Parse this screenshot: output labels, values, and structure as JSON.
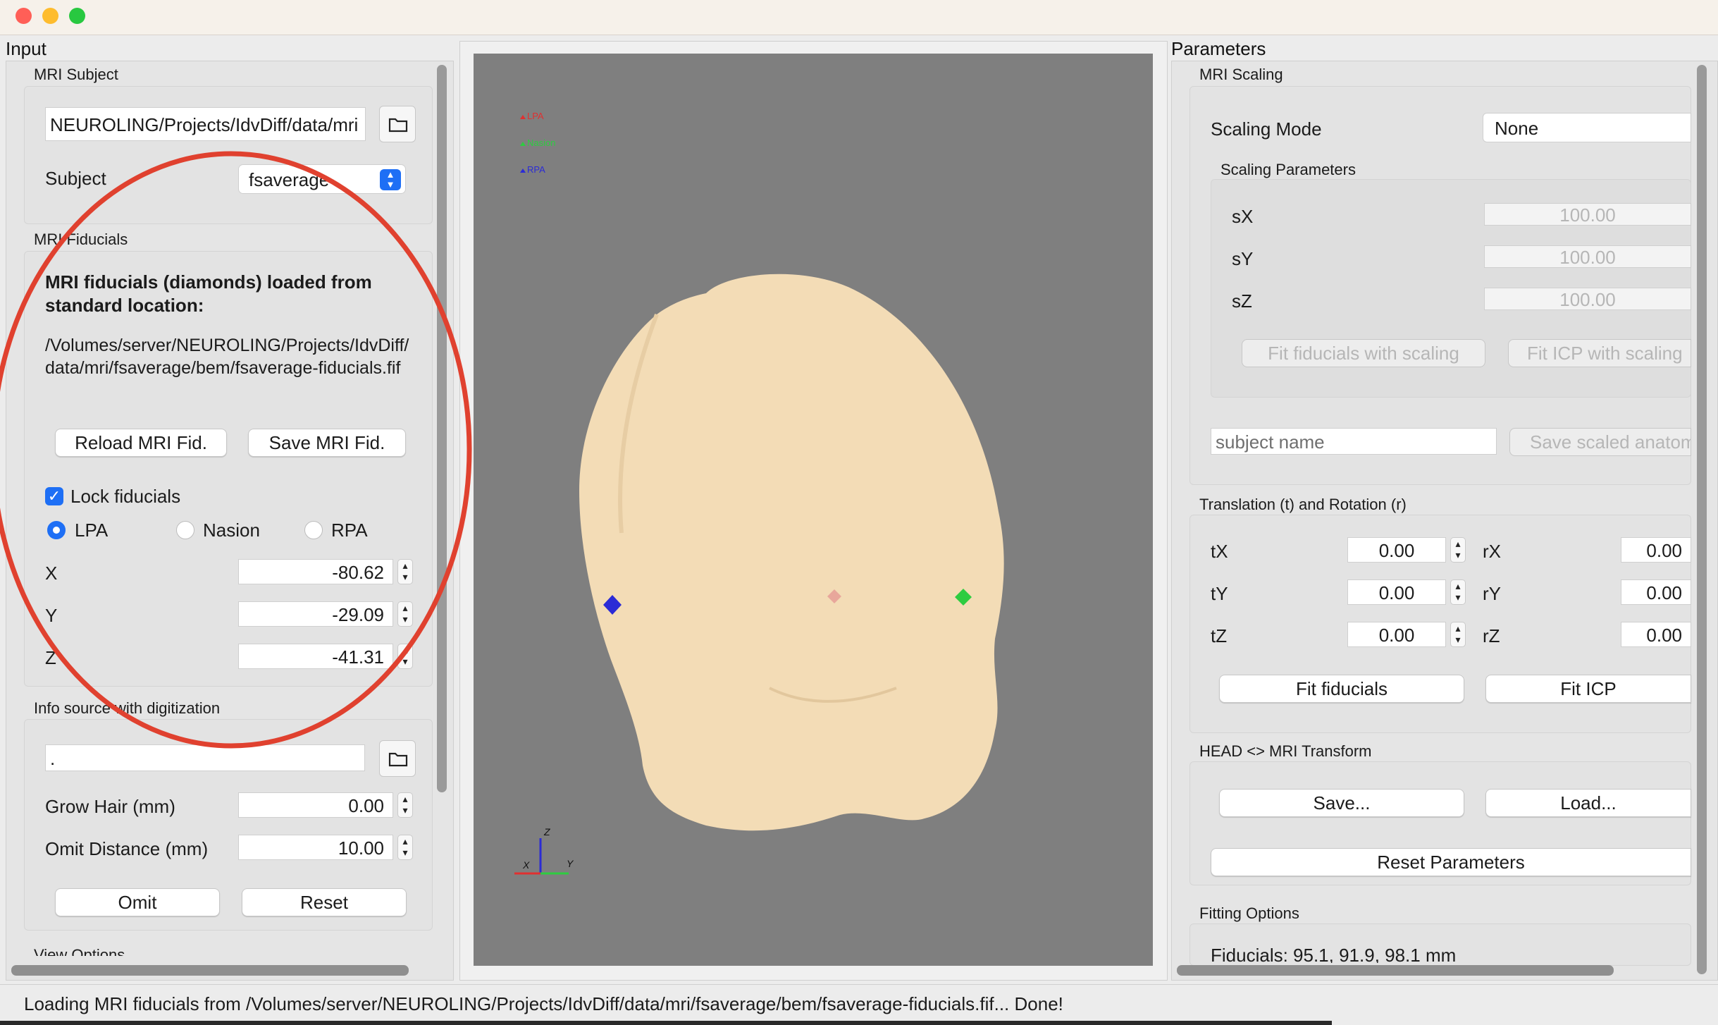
{
  "window": {
    "traffic_lights": [
      "#ff5f57",
      "#febc2e",
      "#28c840"
    ]
  },
  "input_panel": {
    "title": "Input",
    "mri_subject": {
      "group_title": "MRI Subject",
      "path_value": "NEUROLING/Projects/IdvDiff/data/mri",
      "subject_label": "Subject",
      "subject_value": "fsaverage"
    },
    "mri_fiducials": {
      "group_title": "MRI Fiducials",
      "heading": "MRI fiducials (diamonds) loaded from standard location:",
      "path_text": "/Volumes/server/NEUROLING/Projects/IdvDiff/data/mri/fsaverage/bem/fsaverage-fiducials.fif",
      "reload_label": "Reload MRI Fid.",
      "save_label": "Save MRI Fid.",
      "lock_label": "Lock fiducials",
      "lock_checked": true,
      "radio_lpa": "LPA",
      "radio_nasion": "Nasion",
      "radio_rpa": "RPA",
      "selected": "LPA",
      "x_label": "X",
      "x_value": "-80.62",
      "y_label": "Y",
      "y_value": "-29.09",
      "z_label": "Z",
      "z_value": "-41.31"
    },
    "info_source": {
      "group_title": "Info source with digitization",
      "file_value": ".",
      "grow_hair_label": "Grow Hair (mm)",
      "grow_hair_value": "0.00",
      "omit_distance_label": "Omit Distance (mm)",
      "omit_distance_value": "10.00",
      "omit_label": "Omit",
      "reset_label": "Reset"
    },
    "next_group_partial": "View Options"
  },
  "viewer": {
    "background": "#7f7f7f",
    "legend": [
      {
        "label": "LPA",
        "color": "#e03030"
      },
      {
        "label": "Nasion",
        "color": "#2ecc40"
      },
      {
        "label": "RPA",
        "color": "#2b2bd6"
      }
    ],
    "axes": {
      "z": "Z",
      "x": "X",
      "y": "Y"
    },
    "head_color": "#f3dcb6"
  },
  "parameters_panel": {
    "title": "Parameters",
    "mri_scaling": {
      "group_title": "MRI Scaling",
      "scaling_mode_label": "Scaling Mode",
      "scaling_mode_value": "None",
      "scaling_params_title": "Scaling Parameters",
      "sx_label": "sX",
      "sx_value": "100.00",
      "sy_label": "sY",
      "sy_value": "100.00",
      "sz_label": "sZ",
      "sz_value": "100.00",
      "fit_fid_scaling": "Fit fiducials with scaling",
      "fit_icp_scaling": "Fit ICP with scaling",
      "subject_name_placeholder": "subject name",
      "save_scaled": "Save scaled anatomy"
    },
    "translation_rotation": {
      "group_title": "Translation (t) and Rotation (r)",
      "tx_label": "tX",
      "tx_value": "0.00",
      "ty_label": "tY",
      "ty_value": "0.00",
      "tz_label": "tZ",
      "tz_value": "0.00",
      "rx_label": "rX",
      "rx_value": "0.00",
      "ry_label": "rY",
      "ry_value": "0.00",
      "rz_label": "rZ",
      "rz_value": "0.00",
      "fit_fiducials": "Fit fiducials",
      "fit_icp": "Fit ICP"
    },
    "head_mri": {
      "group_title": "HEAD <> MRI Transform",
      "save": "Save...",
      "load": "Load...",
      "reset_params": "Reset Parameters"
    },
    "fitting_options": {
      "group_title": "Fitting Options",
      "fiducials_text": "Fiducials: 95.1, 91.9, 98.1 mm"
    }
  },
  "status_bar": {
    "message": "Loading MRI fiducials from /Volumes/server/NEUROLING/Projects/IdvDiff/data/mri/fsaverage/bem/fsaverage-fiducials.fif... Done!"
  }
}
